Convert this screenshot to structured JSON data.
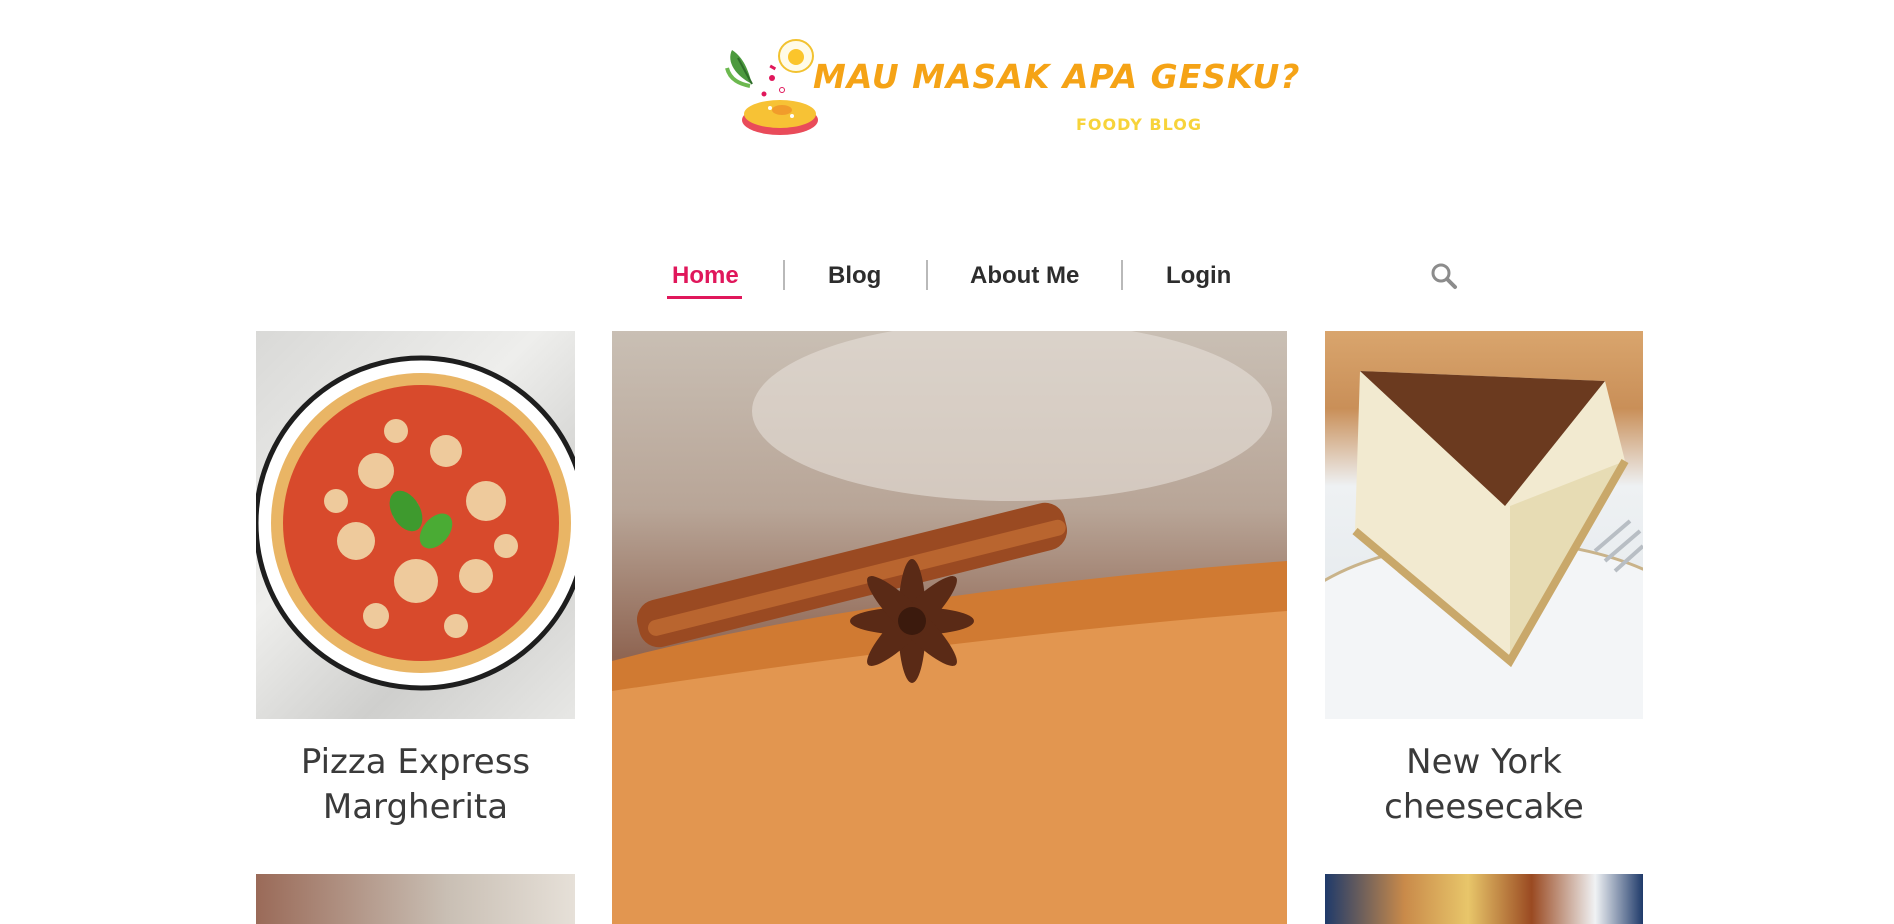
{
  "logo": {
    "title": "MAU MASAK APA GESKU?",
    "subtitle": "FOODY BLOG"
  },
  "nav": {
    "items": [
      {
        "label": "Home",
        "active": true
      },
      {
        "label": "Blog",
        "active": false
      },
      {
        "label": "About Me",
        "active": false
      },
      {
        "label": "Login",
        "active": false
      }
    ],
    "search_icon": "search-icon"
  },
  "posts": {
    "left_top": {
      "title": "Pizza Express Margherita"
    },
    "right_top": {
      "title": "New York cheesecake"
    }
  },
  "colors": {
    "accent": "#e0175b",
    "logo_orange": "#f5a316",
    "logo_yellow": "#f7d33a",
    "text": "#2d2d2d"
  }
}
